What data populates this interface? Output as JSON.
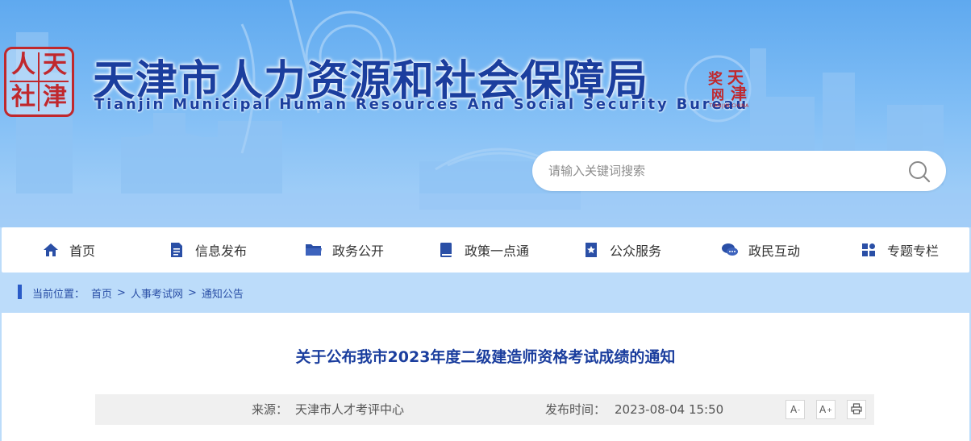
{
  "header": {
    "title": "天津市人力资源和社会保障局",
    "subtitle": "Tianjin Municipal Human Resources And Social Security Bureau",
    "logo_chars": [
      "人",
      "天",
      "社",
      "津"
    ],
    "stamp_chars": [
      "天",
      "津",
      "奖",
      "网"
    ],
    "stamp_caption": "TIANJIN CHINA"
  },
  "search": {
    "placeholder": "请输入关键词搜索",
    "icon": "search-icon"
  },
  "nav": {
    "items": [
      {
        "label": "首页",
        "icon": "home-icon"
      },
      {
        "label": "信息发布",
        "icon": "document-icon"
      },
      {
        "label": "政务公开",
        "icon": "folder-icon"
      },
      {
        "label": "政策一点通",
        "icon": "book-icon"
      },
      {
        "label": "公众服务",
        "icon": "bookmark-star-icon"
      },
      {
        "label": "政民互动",
        "icon": "chat-icon"
      },
      {
        "label": "专题专栏",
        "icon": "grid-icon"
      }
    ]
  },
  "breadcrumb": {
    "prefix": "当前位置：",
    "items": [
      "首页",
      "人事考试网",
      "通知公告"
    ],
    "separator": ">"
  },
  "article": {
    "title": "关于公布我市2023年度二级建造师资格考试成绩的通知",
    "source_label": "来源：",
    "source_value": "天津市人才考评中心",
    "date_label": "发布时间：",
    "date_value": "2023-08-04 15:50",
    "font_decrease_label": "A",
    "font_decrease_mark": "-",
    "font_increase_label": "A",
    "font_increase_mark": "+"
  },
  "colors": {
    "accent": "#1b3e9e",
    "seal_red": "#c0282d",
    "banner_top": "#5fa9ef",
    "page_bg": "#bcdcfa"
  }
}
